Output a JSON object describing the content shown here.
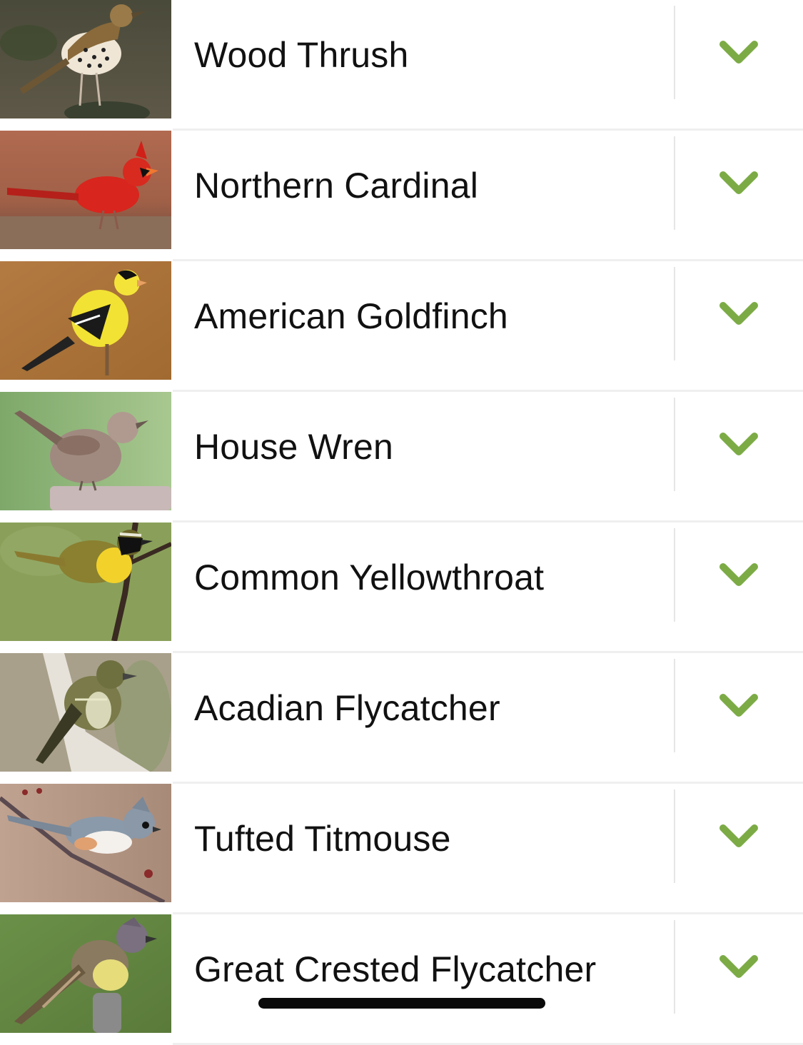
{
  "accent_color": "#7cab46",
  "birds": [
    {
      "name": "Wood Thrush",
      "image": "wood-thrush-photo",
      "expand_icon": "chevron-down-icon"
    },
    {
      "name": "Northern Cardinal",
      "image": "northern-cardinal-photo",
      "expand_icon": "chevron-down-icon"
    },
    {
      "name": "American Goldfinch",
      "image": "american-goldfinch-photo",
      "expand_icon": "chevron-down-icon"
    },
    {
      "name": "House Wren",
      "image": "house-wren-photo",
      "expand_icon": "chevron-down-icon"
    },
    {
      "name": "Common Yellowthroat",
      "image": "common-yellowthroat-photo",
      "expand_icon": "chevron-down-icon"
    },
    {
      "name": "Acadian Flycatcher",
      "image": "acadian-flycatcher-photo",
      "expand_icon": "chevron-down-icon"
    },
    {
      "name": "Tufted Titmouse",
      "image": "tufted-titmouse-photo",
      "expand_icon": "chevron-down-icon"
    },
    {
      "name": "Great Crested Flycatcher",
      "image": "great-crested-flycatcher-photo",
      "expand_icon": "chevron-down-icon"
    }
  ]
}
